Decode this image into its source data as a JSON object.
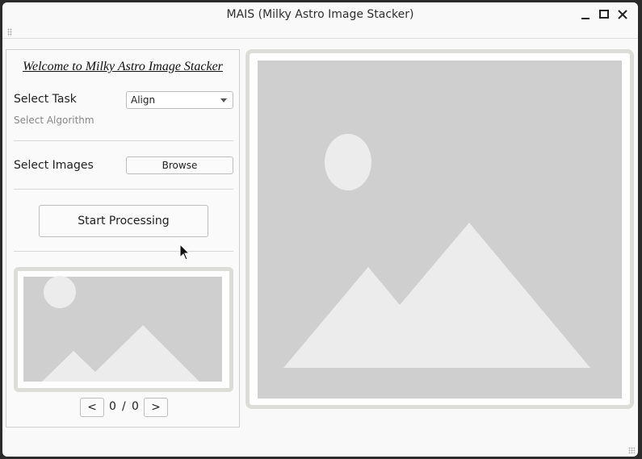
{
  "window": {
    "title": "MAIS (Milky Astro Image Stacker)",
    "minimize_icon": "minimize-icon",
    "maximize_icon": "maximize-icon",
    "close_icon": "close-icon"
  },
  "left_panel": {
    "welcome": "Welcome to Milky Astro Image Stacker",
    "select_task_label": "Select Task",
    "task_combo_value": "Align",
    "select_algorithm_label": "Select Algorithm",
    "select_images_label": "Select Images",
    "browse_label": "Browse",
    "start_label": "Start Processing",
    "prev_label": "<",
    "next_label": ">",
    "current_index": "0",
    "slash": "/",
    "total": "0"
  },
  "colors": {
    "placeholder_bg": "#cfcfcf",
    "placeholder_fg": "#ececec",
    "frame_border": "#dcdcd8"
  }
}
